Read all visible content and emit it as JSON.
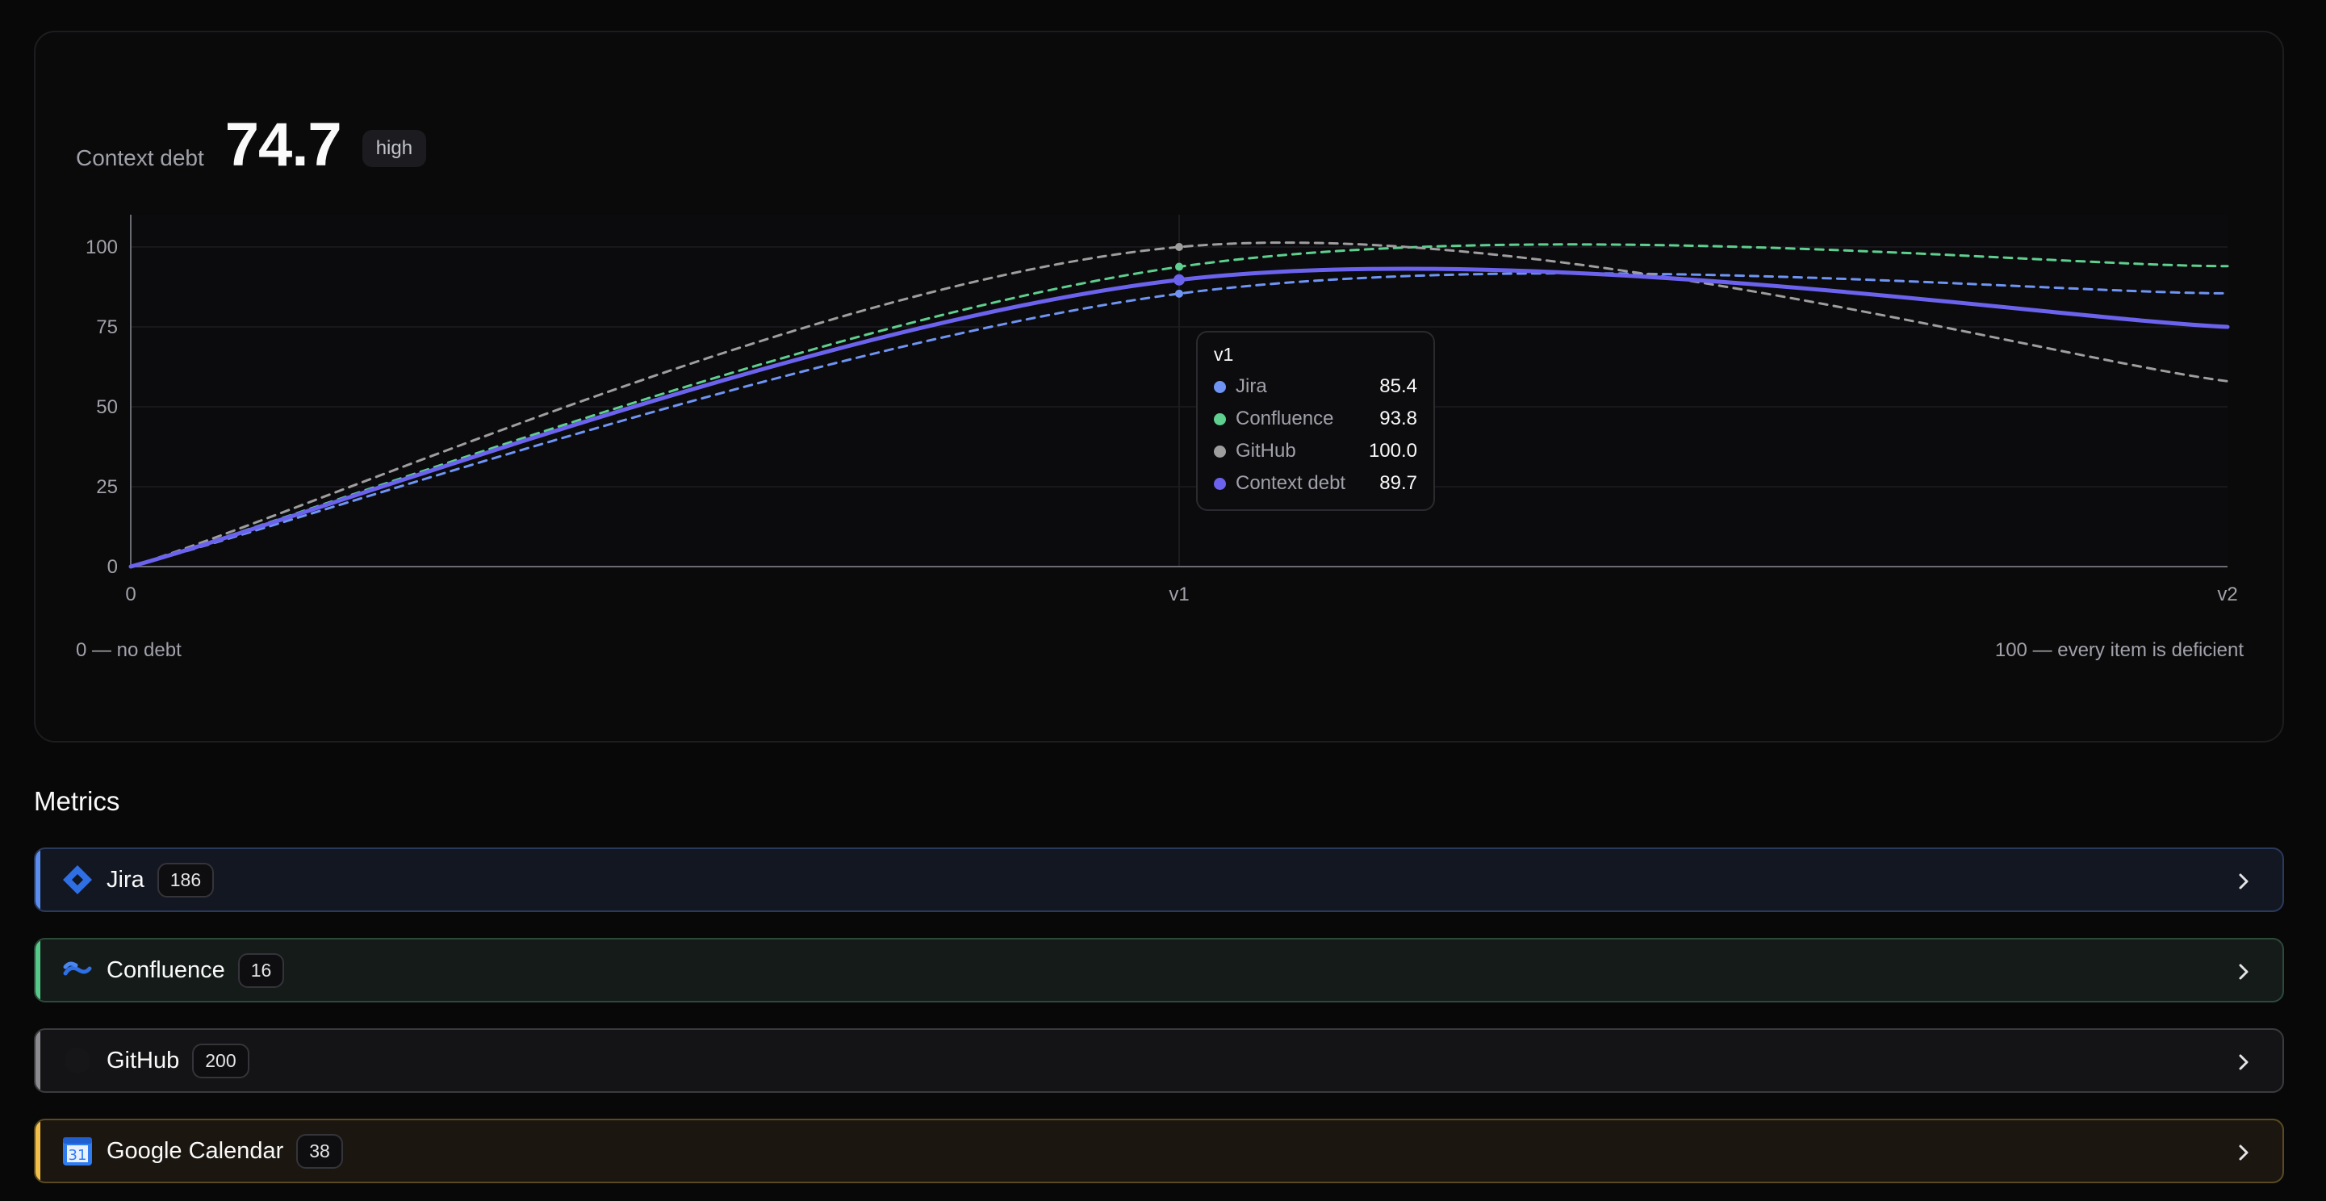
{
  "summary": {
    "label": "Context debt",
    "value": "74.7",
    "badge": "high",
    "scale_min_label": "0 — no debt",
    "scale_max_label": "100 — every item is deficient"
  },
  "chart_data": {
    "type": "line",
    "x": [
      "0",
      "v1",
      "v2"
    ],
    "ylim": [
      0,
      100
    ],
    "yticks": [
      0,
      25,
      50,
      75,
      100
    ],
    "grid": true,
    "series": [
      {
        "name": "Jira",
        "color": "#6f94f4",
        "style": "dashed",
        "values": [
          0,
          85.4,
          85.5
        ]
      },
      {
        "name": "Confluence",
        "color": "#5fcf8f",
        "style": "dashed",
        "values": [
          0,
          93.8,
          94
        ]
      },
      {
        "name": "GitHub",
        "color": "#9e9e9e",
        "style": "dashed",
        "values": [
          0,
          100.0,
          58
        ]
      },
      {
        "name": "Context debt",
        "color": "#6b63ee",
        "style": "solid",
        "values": [
          0,
          89.7,
          75
        ]
      }
    ],
    "tooltip": {
      "title": "v1",
      "rows": [
        {
          "name": "Jira",
          "value": "85.4",
          "color": "#6f94f4"
        },
        {
          "name": "Confluence",
          "value": "93.8",
          "color": "#5fcf8f"
        },
        {
          "name": "GitHub",
          "value": "100.0",
          "color": "#9e9e9e"
        },
        {
          "name": "Context debt",
          "value": "89.7",
          "color": "#6b63ee"
        }
      ]
    }
  },
  "metrics": {
    "title": "Metrics",
    "items": [
      {
        "name": "Jira",
        "count": "186",
        "icon": "jira-icon",
        "accent": "#5b8def",
        "bg": "#121722",
        "border": "#2a3a5c"
      },
      {
        "name": "Confluence",
        "count": "16",
        "icon": "confluence-icon",
        "accent": "#56c98a",
        "bg": "#141b18",
        "border": "#2c4a3a"
      },
      {
        "name": "GitHub",
        "count": "200",
        "icon": "github-icon",
        "accent": "#8b8b90",
        "bg": "#141416",
        "border": "#3a3a3f"
      },
      {
        "name": "Google Calendar",
        "count": "38",
        "icon": "google-calendar-icon",
        "accent": "#f2c04a",
        "bg": "#1b1710",
        "border": "#5a4a22"
      }
    ]
  }
}
